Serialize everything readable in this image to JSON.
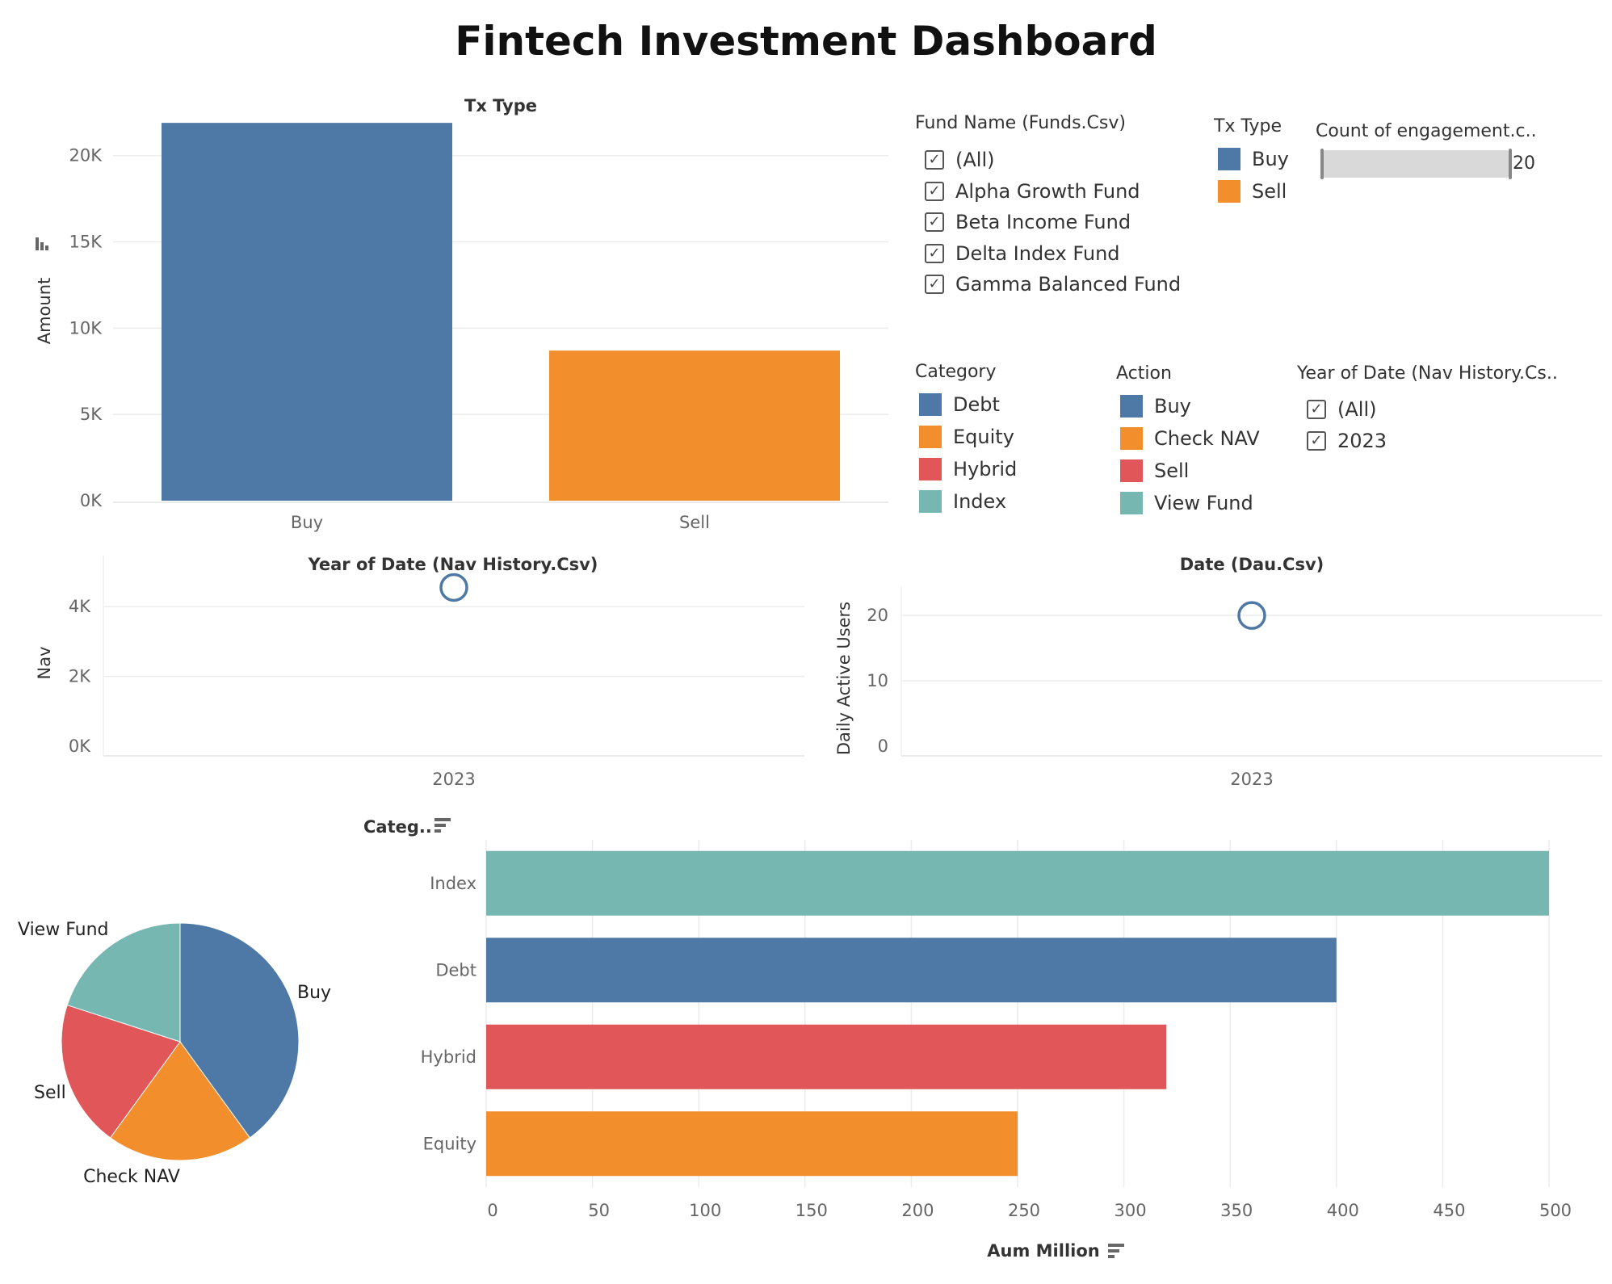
{
  "title": "Fintech Investment Dashboard",
  "colors": {
    "blue": "#4e79a7",
    "orange": "#f28e2b",
    "red": "#e15759",
    "teal": "#76b7b2"
  },
  "filters": {
    "fund_name": {
      "title": "Fund Name (Funds.Csv)",
      "items": [
        {
          "label": "(All)",
          "checked": true
        },
        {
          "label": "Alpha Growth Fund",
          "checked": true
        },
        {
          "label": "Beta Income Fund",
          "checked": true
        },
        {
          "label": "Delta Index Fund",
          "checked": true
        },
        {
          "label": "Gamma Balanced Fund",
          "checked": true
        }
      ]
    },
    "year_of_date": {
      "title": "Year of Date (Nav History.Cs..",
      "items": [
        {
          "label": "(All)",
          "checked": true
        },
        {
          "label": "2023",
          "checked": true
        }
      ]
    },
    "engagement_slider": {
      "title": "Count of engagement.c..",
      "value": "20"
    }
  },
  "legends": {
    "tx_type": {
      "title": "Tx Type",
      "items": [
        {
          "label": "Buy",
          "color": "#4e79a7"
        },
        {
          "label": "Sell",
          "color": "#f28e2b"
        }
      ]
    },
    "category": {
      "title": "Category",
      "items": [
        {
          "label": "Debt",
          "color": "#4e79a7"
        },
        {
          "label": "Equity",
          "color": "#f28e2b"
        },
        {
          "label": "Hybrid",
          "color": "#e15759"
        },
        {
          "label": "Index",
          "color": "#76b7b2"
        }
      ]
    },
    "action": {
      "title": "Action",
      "items": [
        {
          "label": "Buy",
          "color": "#4e79a7"
        },
        {
          "label": "Check NAV",
          "color": "#f28e2b"
        },
        {
          "label": "Sell",
          "color": "#e15759"
        },
        {
          "label": "View Fund",
          "color": "#76b7b2"
        }
      ]
    }
  },
  "chart_data": [
    {
      "type": "bar",
      "title": "Tx Type",
      "xlabel": "",
      "ylabel": "Amount",
      "categories": [
        "Buy",
        "Sell"
      ],
      "values": [
        21900,
        8700
      ],
      "colors": [
        "#4e79a7",
        "#f28e2b"
      ],
      "ylim": [
        0,
        22000
      ],
      "yticks": [
        0,
        5000,
        10000,
        15000,
        20000
      ],
      "ytick_labels": [
        "0K",
        "5K",
        "10K",
        "15K",
        "20K"
      ],
      "grid": true
    },
    {
      "type": "scatter",
      "title": "Year of Date (Nav History.Csv)",
      "xlabel": "",
      "ylabel": "Nav",
      "x": [
        "2023"
      ],
      "y": [
        4550
      ],
      "ylim": [
        0,
        5000
      ],
      "yticks": [
        0,
        2000,
        4000
      ],
      "ytick_labels": [
        "0K",
        "2K",
        "4K"
      ],
      "grid": true
    },
    {
      "type": "scatter",
      "title": "Date (Dau.Csv)",
      "xlabel": "",
      "ylabel": "Daily Active Users",
      "x": [
        "2023"
      ],
      "y": [
        20
      ],
      "ylim": [
        0,
        22
      ],
      "yticks": [
        0,
        10,
        20
      ],
      "ytick_labels": [
        "0",
        "10",
        "20"
      ],
      "grid": true
    },
    {
      "type": "pie",
      "title": "",
      "labels": [
        "Buy",
        "Check NAV",
        "Sell",
        "View Fund"
      ],
      "values": [
        40,
        20,
        20,
        20
      ],
      "colors": [
        "#4e79a7",
        "#f28e2b",
        "#e15759",
        "#76b7b2"
      ]
    },
    {
      "type": "bar",
      "orientation": "horizontal",
      "title": "",
      "ylabel": "Categ..",
      "xlabel": "Aum Million",
      "categories": [
        "Index",
        "Debt",
        "Hybrid",
        "Equity"
      ],
      "values": [
        500,
        400,
        320,
        250
      ],
      "colors": [
        "#76b7b2",
        "#4e79a7",
        "#e15759",
        "#f28e2b"
      ],
      "xlim": [
        0,
        510
      ],
      "xticks": [
        0,
        50,
        100,
        150,
        200,
        250,
        300,
        350,
        400,
        450,
        500
      ],
      "grid": true
    }
  ]
}
